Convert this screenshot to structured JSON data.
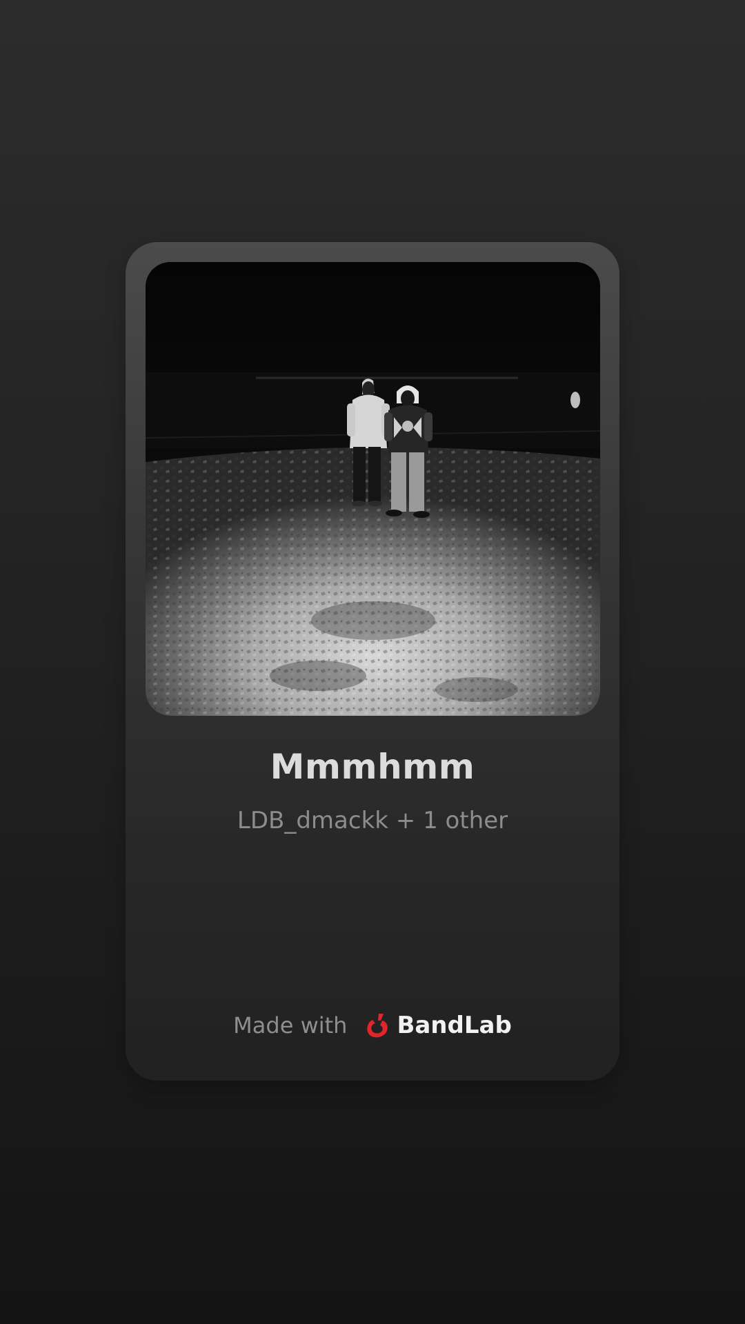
{
  "track": {
    "title": "Mmmhmm",
    "artists": "LDB_dmackk + 1 other"
  },
  "branding": {
    "made_with": "Made with",
    "logo_text": "BandLab",
    "logo_color": "#e0262d"
  },
  "artwork": {
    "icon": "cover-photo",
    "style": "grayscale night photo"
  }
}
